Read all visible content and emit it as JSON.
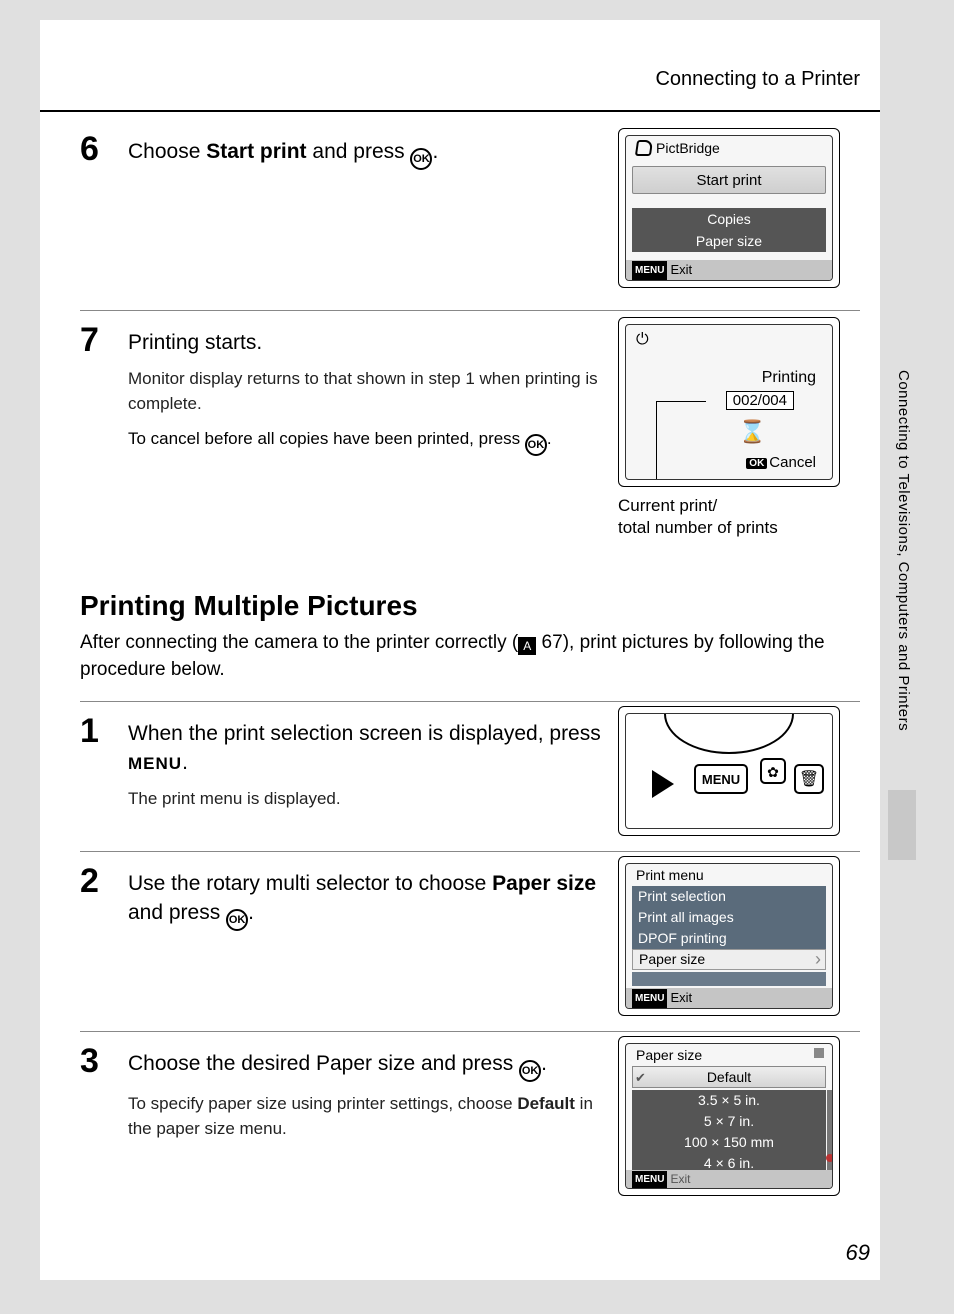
{
  "header": {
    "title": "Connecting to a Printer"
  },
  "side": {
    "chapter": "Connecting to Televisions, Computers and Printers"
  },
  "page_number": "69",
  "step6": {
    "num": "6",
    "head_pre": "Choose ",
    "head_bold": "Start print",
    "head_post": " and press ",
    "ok": "OK",
    "period": ".",
    "lcd": {
      "pb_label": "PictBridge",
      "start": "Start print",
      "copies": "Copies",
      "paper": "Paper size",
      "menu_badge": "MENU",
      "exit": "Exit"
    }
  },
  "step7": {
    "num": "7",
    "head": "Printing starts.",
    "sub1": "Monitor display returns to that shown in step 1 when printing is complete.",
    "sub2_pre": "To cancel before all copies have been printed, press ",
    "ok": "OK",
    "period": ".",
    "lcd": {
      "printing": "Printing",
      "counter": "002/004",
      "hourglass": "⌛",
      "ok_badge": "OK",
      "cancel": "Cancel"
    },
    "caption": "Current print/\ntotal number of prints"
  },
  "section": {
    "title": "Printing Multiple Pictures",
    "para_pre": "After connecting the camera to the printer correctly (",
    "ref_icon": "A",
    "ref_page": " 67",
    "para_post": "), print pictures by following the procedure below."
  },
  "step1b": {
    "num": "1",
    "head_pre": "When the print selection screen is displayed, press ",
    "menu_word": "MENU",
    "period": ".",
    "sub": "The print menu is displayed.",
    "fig": {
      "menu": "MENU",
      "flower": "✿",
      "trash": "🗑"
    }
  },
  "step2b": {
    "num": "2",
    "head_pre": "Use the rotary multi selector to choose ",
    "bold": "Paper size",
    "head_mid": " and press ",
    "ok": "OK",
    "period": ".",
    "lcd": {
      "title": "Print menu",
      "r1": "Print selection",
      "r2": "Print all images",
      "r3": "DPOF printing",
      "sel": "Paper size",
      "menu_badge": "MENU",
      "exit": "Exit"
    }
  },
  "step3b": {
    "num": "3",
    "head_pre": "Choose the desired Paper size and press ",
    "ok": "OK",
    "period": ".",
    "sub_pre": "To specify paper size using printer settings, choose ",
    "sub_bold": "Default",
    "sub_post": " in the paper size menu.",
    "lcd": {
      "title": "Paper size",
      "sel": "Default",
      "p1": "3.5 × 5 in.",
      "p2": "5 × 7 in.",
      "p3": "100 × 150 mm",
      "p4": "4 × 6 in.",
      "menu_badge": "MENU",
      "exit": "Exit"
    }
  }
}
